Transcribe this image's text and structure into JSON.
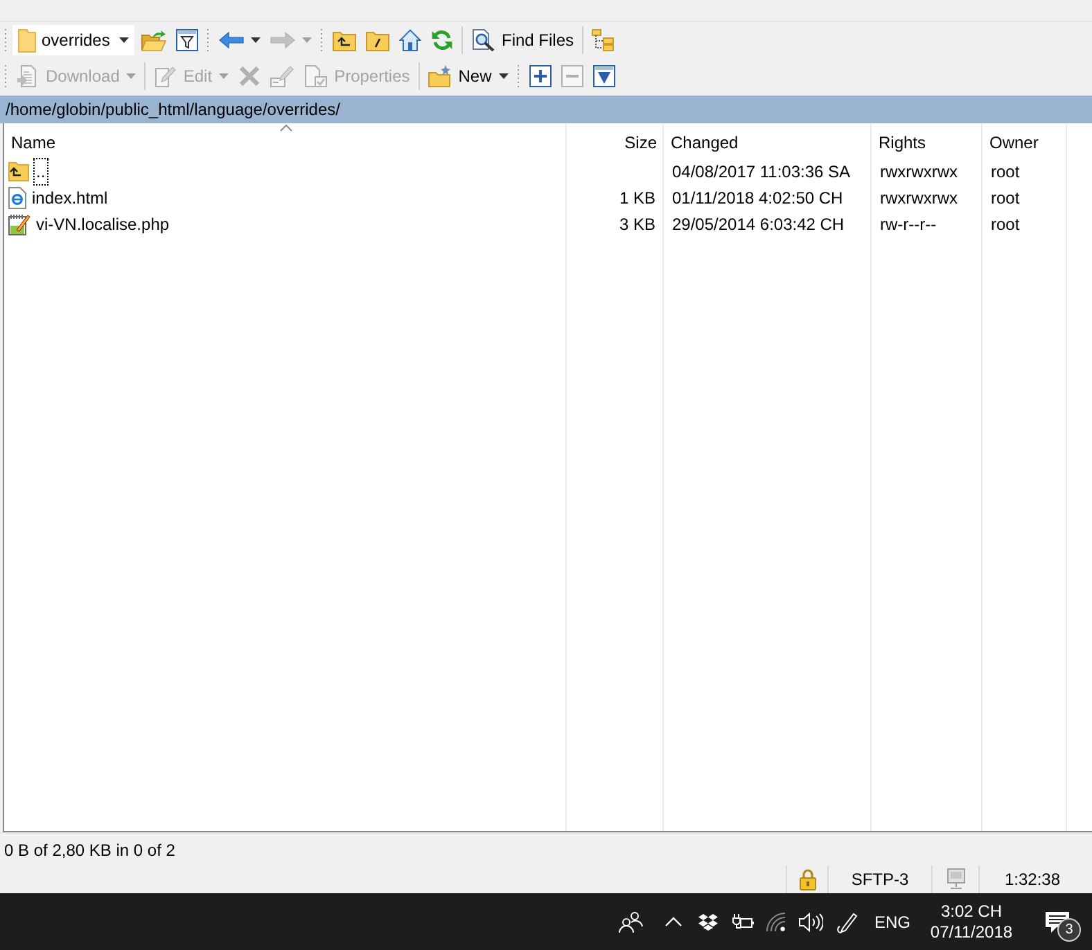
{
  "navigation_toolbar": {
    "location_field": {
      "value": "overrides"
    },
    "back_button": {
      "disabled": false
    },
    "forward_button": {
      "disabled": true
    },
    "find_files_button": {
      "label": "Find Files"
    }
  },
  "file_toolbar": {
    "download_button": {
      "label": "Download",
      "disabled": true
    },
    "edit_button": {
      "label": "Edit",
      "disabled": true
    },
    "delete_button": {
      "disabled": true
    },
    "rename_button": {
      "disabled": true
    },
    "properties_button": {
      "label": "Properties",
      "disabled": true
    },
    "new_button": {
      "label": "New",
      "disabled": false
    },
    "select_button": {
      "disabled": false
    },
    "unselect_button": {
      "disabled": true
    },
    "filter_button": {
      "disabled": false
    }
  },
  "path_bar": {
    "path": "/home/globin/public_html/language/overrides/"
  },
  "file_list": {
    "columns": [
      {
        "label": "Name",
        "sorted": true
      },
      {
        "label": "Size",
        "sorted": false
      },
      {
        "label": "Changed",
        "sorted": false
      },
      {
        "label": "Rights",
        "sorted": false
      },
      {
        "label": "Owner",
        "sorted": false
      }
    ],
    "rows": [
      {
        "kind": "parent",
        "name": "..",
        "changed": "04/08/2017 11:03:36 SA",
        "rights": "rwxrwxrwx",
        "owner": "root",
        "selected": false,
        "focused": true
      },
      {
        "kind": "html",
        "name": "index.html",
        "size": "1 KB",
        "changed": "01/11/2018 4:02:50 CH",
        "rights": "rwxrwxrwx",
        "owner": "root",
        "selected": false,
        "focused": false
      },
      {
        "kind": "php",
        "name": "vi-VN.localise.php",
        "size": "3 KB",
        "changed": "29/05/2014 6:03:42 CH",
        "rights": "rw-r--r--",
        "owner": "root",
        "selected": false,
        "focused": false
      }
    ]
  },
  "status_bar": {
    "summary": "0 B of 2,80 KB in 0 of 2",
    "protocol": "SFTP-3",
    "elapsed": "1:32:38"
  },
  "taskbar": {
    "language": "ENG",
    "time": "3:02 CH",
    "date": "07/11/2018",
    "notification_count": "3"
  }
}
